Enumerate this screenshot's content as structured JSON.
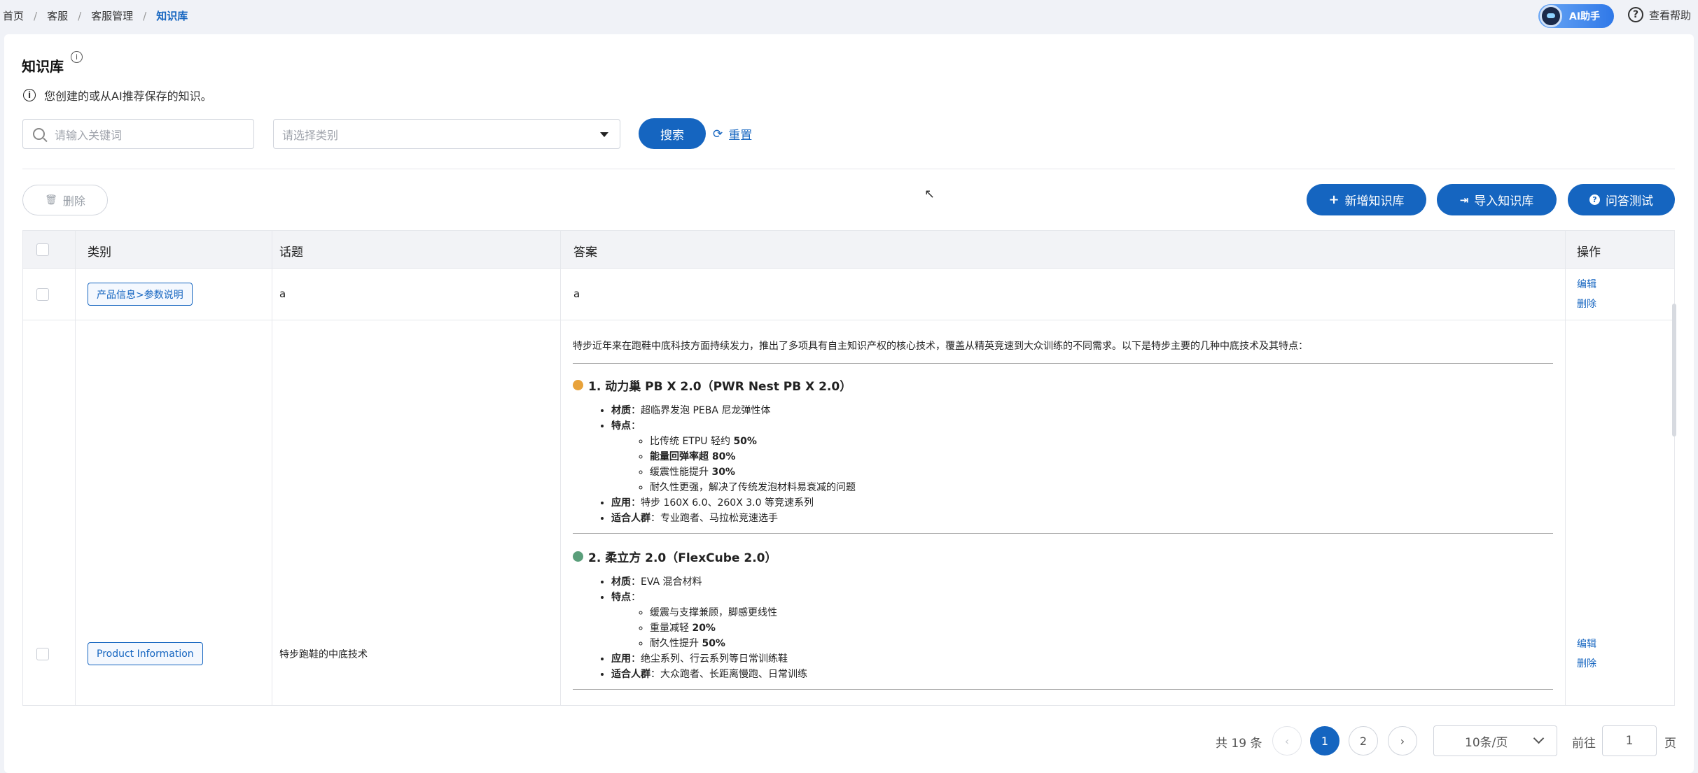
{
  "breadcrumb": {
    "items": [
      "首页",
      "客服",
      "客服管理"
    ],
    "current": "知识库",
    "separator": "/"
  },
  "header": {
    "ai_assistant_label": "AI助手",
    "help_label": "查看帮助"
  },
  "page": {
    "title": "知识库",
    "description": "您创建的或从AI推荐保存的知识。"
  },
  "filters": {
    "keyword_placeholder": "请输入关键词",
    "category_placeholder": "请选择类别",
    "search_label": "搜索",
    "reset_label": "重置"
  },
  "toolbar": {
    "delete_label": "删除",
    "add_label": "新增知识库",
    "import_label": "导入知识库",
    "qa_test_label": "问答测试"
  },
  "table": {
    "columns": [
      "类别",
      "话题",
      "答案",
      "操作"
    ],
    "rows": [
      {
        "category": "产品信息>参数说明",
        "topic": "a",
        "answer": "a",
        "actions": [
          "编辑",
          "删除"
        ]
      },
      {
        "category": "Product Information",
        "topic": "特步跑鞋的中底技术",
        "answer": {
          "intro": "特步近年来在跑鞋中底科技方面持续发力，推出了多项具有自主知识产权的核心技术，覆盖从精英竞速到大众训练的不同需求。以下是特步主要的几种中底技术及其特点：",
          "sections": [
            {
              "heading": "1. 动力巢 PB X 2.0（PWR Nest PB X 2.0）",
              "dot_color": "#e8a23a",
              "material_label": "材质",
              "material": "超临界发泡 PEBA 尼龙弹性体",
              "features_label": "特点",
              "features": [
                {
                  "text": "比传统 ETPU 轻约 ",
                  "bold": "50%"
                },
                {
                  "text": "能量回弹率超 ",
                  "bold": "80%",
                  "all_bold": true
                },
                {
                  "text": "缓震性能提升 ",
                  "bold": "30%"
                },
                {
                  "text": "耐久性更强，解决了传统发泡材料易衰减的问题",
                  "bold": ""
                }
              ],
              "application_label": "应用",
              "application": "特步 160X 6.0、260X 3.0 等竞速系列",
              "audience_label": "适合人群",
              "audience": "专业跑者、马拉松竞速选手"
            },
            {
              "heading": "2. 柔立方 2.0（FlexCube 2.0）",
              "dot_color": "#5a9e7a",
              "material_label": "材质",
              "material": "EVA 混合材料",
              "features_label": "特点",
              "features": [
                {
                  "text": "缓震与支撑兼顾，脚感更线性",
                  "bold": ""
                },
                {
                  "text": "重量减轻 ",
                  "bold": "20%"
                },
                {
                  "text": "耐久性提升 ",
                  "bold": "50%"
                }
              ],
              "application_label": "应用",
              "application": "绝尘系列、行云系列等日常训练鞋",
              "audience_label": "适合人群",
              "audience": "大众跑者、长距离慢跑、日常训练"
            }
          ]
        },
        "actions": [
          "编辑",
          "删除"
        ]
      }
    ]
  },
  "pagination": {
    "total_text": "共 19 条",
    "pages": [
      "1",
      "2"
    ],
    "current_page": "1",
    "page_size": "10条/页",
    "goto_label": "前往",
    "goto_value": "1",
    "goto_suffix": "页"
  },
  "colors": {
    "primary": "#1565c0",
    "background": "#f0f2f7"
  }
}
